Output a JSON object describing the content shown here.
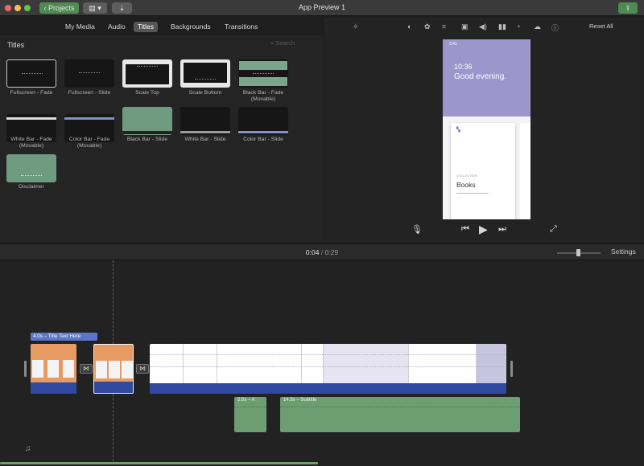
{
  "window": {
    "title": "App Preview 1",
    "projects_button": "Projects"
  },
  "browser": {
    "tabs": [
      {
        "label": "My Media"
      },
      {
        "label": "Audio"
      },
      {
        "label": "Titles"
      },
      {
        "label": "Backgrounds"
      },
      {
        "label": "Transitions"
      }
    ],
    "active_tab": "Titles",
    "heading": "Titles",
    "search_placeholder": "Search",
    "titles": [
      {
        "label": "Fullscreen - Fade",
        "selected": true
      },
      {
        "label": "Fullscreen - Slide"
      },
      {
        "label": "Scale Top"
      },
      {
        "label": "Scale Bottom"
      },
      {
        "label": "Black Bar - Fade (Movable)"
      },
      {
        "label": "White Bar - Fade (Movable)"
      },
      {
        "label": "Color Bar - Fade (Movable)"
      },
      {
        "label": "Black Bar - Slide"
      },
      {
        "label": "White Bar - Slide"
      },
      {
        "label": "Color Bar - Slide"
      },
      {
        "label": "Disclaimer"
      }
    ]
  },
  "viewer": {
    "reset_all": "Reset All",
    "tools": [
      "magic-wand-icon",
      "color-balance-icon",
      "color-correction-icon",
      "crop-icon",
      "stabilization-icon",
      "volume-icon",
      "equalizer-icon",
      "speed-icon",
      "noise-reduction-icon",
      "info-icon"
    ],
    "phone": {
      "status_time": "9:41",
      "time": "10:36",
      "greeting": "Good evening.",
      "card_caption": "COLLECTION",
      "card_title": "Books"
    }
  },
  "timeline": {
    "current_time": "0:04",
    "separator": "/",
    "total_time": "0:29",
    "settings_label": "Settings",
    "title_clip_label": "4.0s – Title Text Here",
    "audio_clips": [
      {
        "label": "2.0s – A"
      },
      {
        "label": "14.8s – Subtitle"
      }
    ]
  },
  "colors": {
    "accent_green": "#6c9e72",
    "title_blue": "#5b77c9",
    "clip_orange": "#e69b63",
    "clip_strip_blue": "#2f4aa0",
    "phone_purple": "#9c96cc"
  }
}
